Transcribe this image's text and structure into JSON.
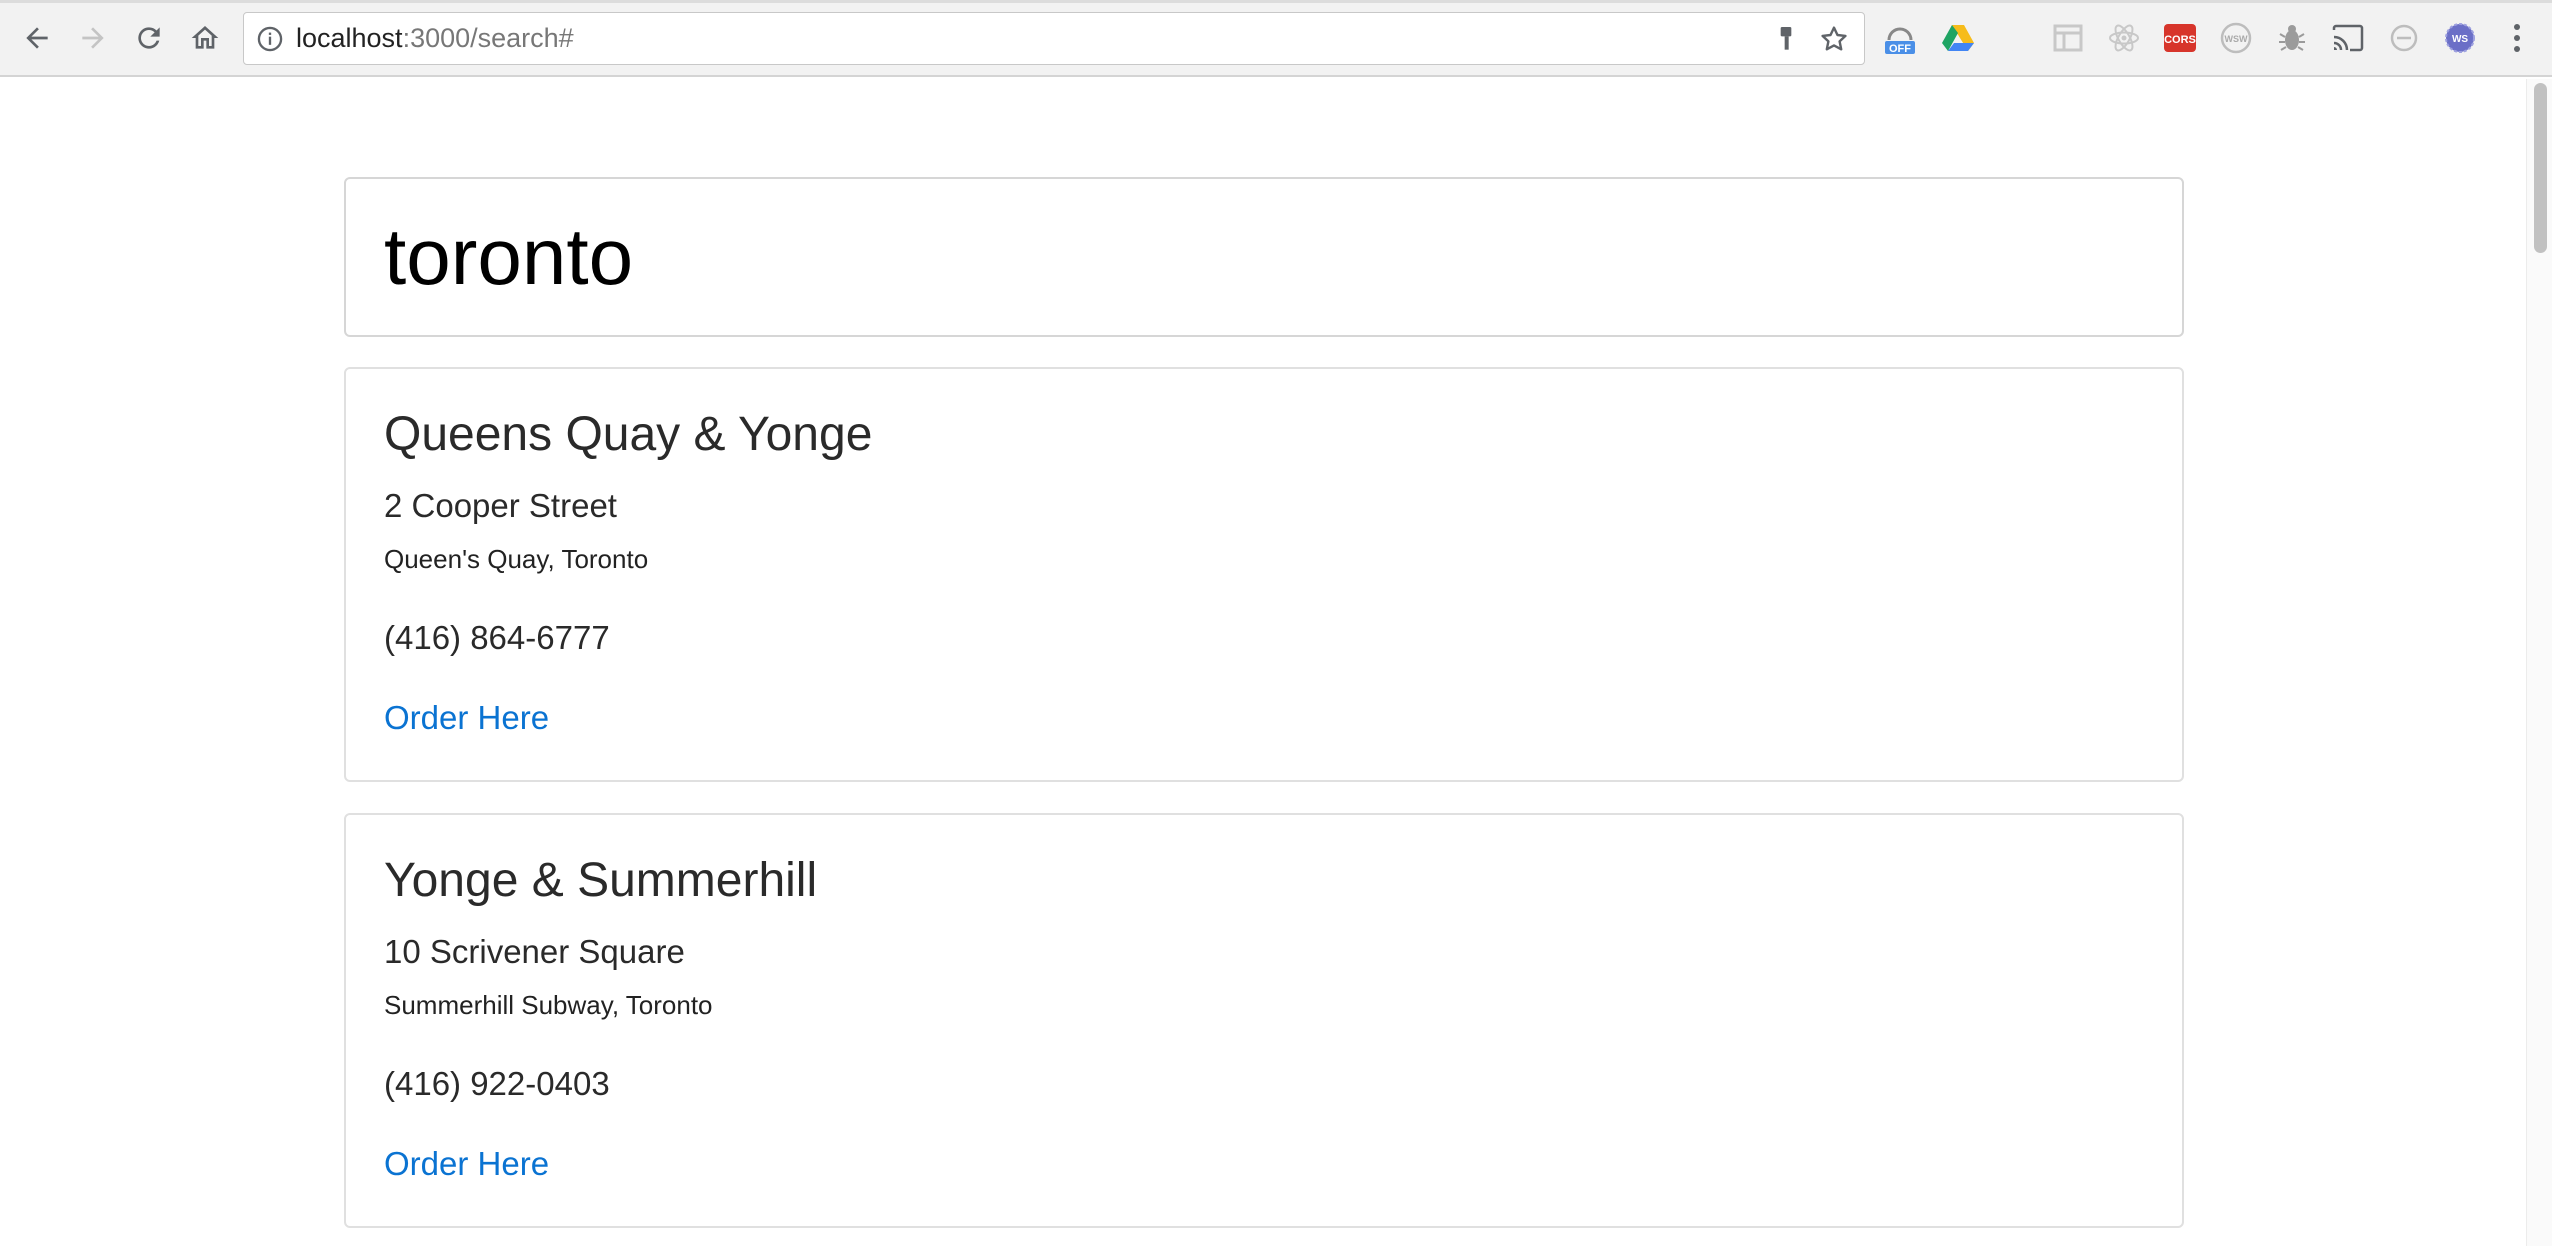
{
  "browser": {
    "url_host": "localhost",
    "url_path": ":3000/search#",
    "extensions": [
      {
        "icon": "ext-off-icon",
        "badge": "OFF",
        "color": "#4a8fe7"
      },
      {
        "icon": "google-drive-icon"
      },
      {
        "icon": "ext-crescent-icon"
      },
      {
        "icon": "ext-layout-icon"
      },
      {
        "icon": "react-devtools-icon"
      },
      {
        "icon": "cors-icon",
        "badge": "CORS",
        "color": "#d7352b"
      },
      {
        "icon": "wsw-icon",
        "badge": "WSW"
      },
      {
        "icon": "bug-icon"
      },
      {
        "icon": "cast-icon"
      },
      {
        "icon": "blocked-circle-icon"
      },
      {
        "icon": "ws-icon",
        "badge": "WS"
      }
    ]
  },
  "search": {
    "value": "toronto"
  },
  "results": [
    {
      "name": "Queens Quay & Yonge",
      "street": "2 Cooper Street",
      "area": "Queen's Quay, Toronto",
      "phone": "(416) 864-6777",
      "order_label": "Order Here"
    },
    {
      "name": "Yonge & Summerhill",
      "street": "10 Scrivener Square",
      "area": "Summerhill Subway, Toronto",
      "phone": "(416) 922-0403",
      "order_label": "Order Here"
    }
  ],
  "colors": {
    "link": "#0a73d2",
    "text": "#2a2a2a",
    "border": "#e0e0e0"
  }
}
